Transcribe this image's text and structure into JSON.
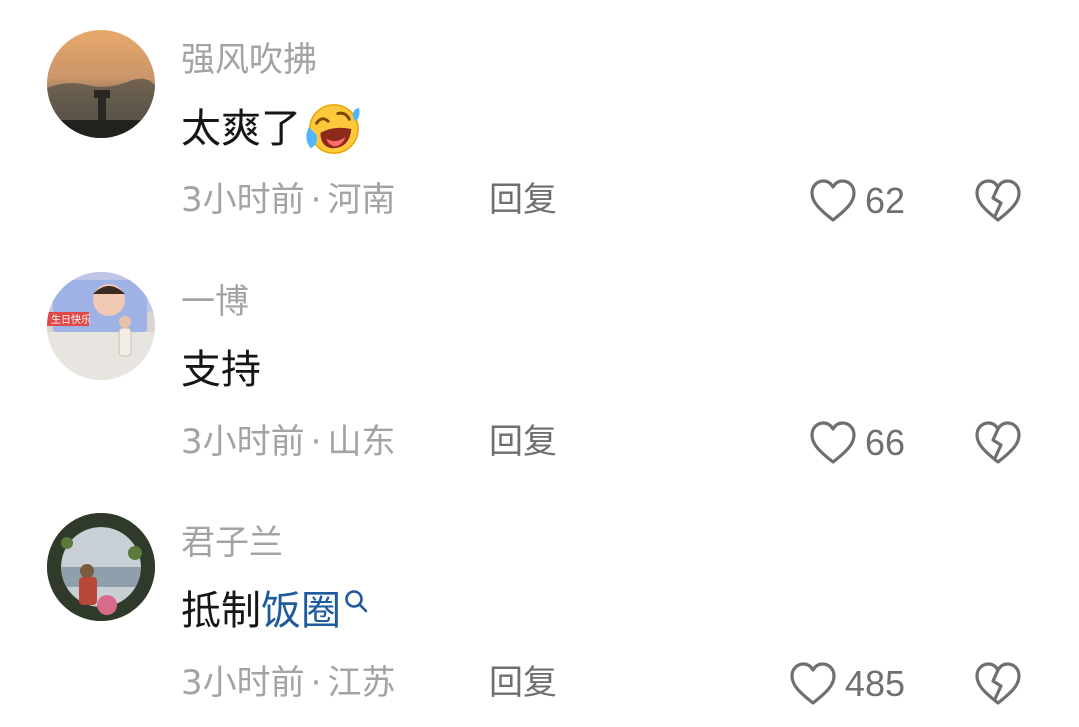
{
  "comments": [
    {
      "username": "强风吹拂",
      "content": "太爽了",
      "content_link": "",
      "emoji": "laughing-crying-emoji",
      "time": "3小时前",
      "location": "河南",
      "reply_label": "回复",
      "likes": "62"
    },
    {
      "username": "一博",
      "content": "支持",
      "content_link": "",
      "emoji": "",
      "time": "3小时前",
      "location": "山东",
      "reply_label": "回复",
      "likes": "66"
    },
    {
      "username": "君子兰",
      "content": "抵制",
      "content_link": "饭圈",
      "emoji": "",
      "time": "3小时前",
      "location": "江苏",
      "reply_label": "回复",
      "likes": "485"
    }
  ],
  "separator": "·",
  "colors": {
    "meta": "#a3a3a3",
    "text": "#161616",
    "link": "#1d5a9e",
    "action": "#6f6f6f"
  },
  "icons": {
    "like": "heart-outline-icon",
    "dislike": "broken-heart-icon",
    "search": "search-mini-icon"
  }
}
